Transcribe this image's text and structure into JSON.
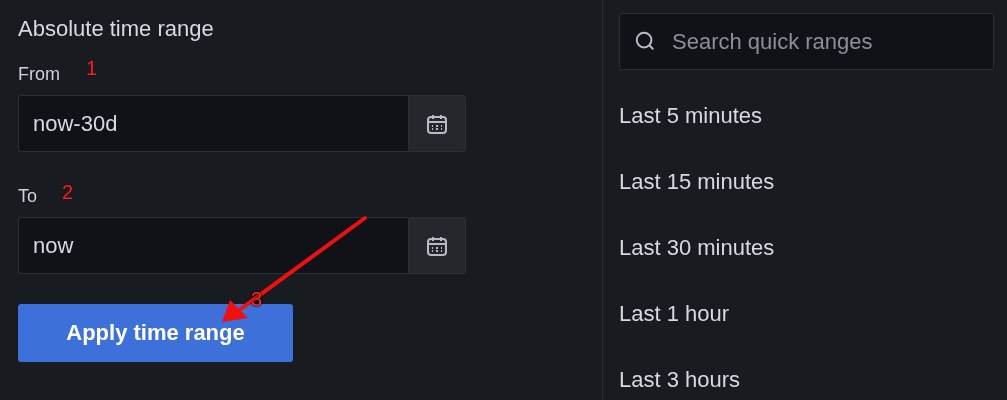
{
  "time_range_form": {
    "title": "Absolute time range",
    "fields": [
      {
        "label": "From",
        "value": "now-30d"
      },
      {
        "label": "To",
        "value": "now"
      }
    ],
    "apply_button": "Apply time range"
  },
  "annotations": {
    "markers": [
      "1",
      "2",
      "3"
    ]
  },
  "quick_ranges": {
    "search": {
      "placeholder": "Search quick ranges"
    },
    "items": [
      "Last 5 minutes",
      "Last 15 minutes",
      "Last 30 minutes",
      "Last 1 hour",
      "Last 3 hours"
    ]
  }
}
